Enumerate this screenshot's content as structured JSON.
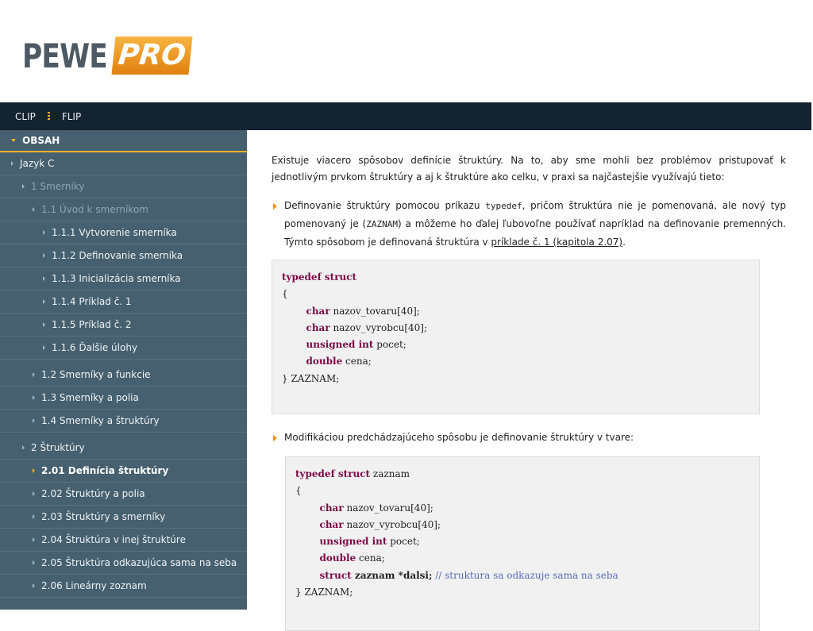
{
  "brand": {
    "part1": "PEWE",
    "part2": "PRO"
  },
  "topbar": {
    "clip": "CLIP",
    "flip": "FLIP"
  },
  "sidebar": {
    "heading": "OBSAH",
    "items": [
      {
        "label": "Jazyk C"
      },
      {
        "label": "1 Smerníky"
      },
      {
        "label": "1.1 Úvod k smerníkom"
      },
      {
        "label": "1.1.1 Vytvorenie smerníka"
      },
      {
        "label": "1.1.2 Definovanie smerníka"
      },
      {
        "label": "1.1.3 Inicializácia smerníka"
      },
      {
        "label": "1.1.4 Príklad č. 1"
      },
      {
        "label": "1.1.5 Príklad č. 2"
      },
      {
        "label": "1.1.6 Ďalšie úlohy"
      },
      {
        "label": "1.2 Smerníky a funkcie"
      },
      {
        "label": "1.3 Smerníky a polia"
      },
      {
        "label": "1.4 Smerníky a štruktúry"
      },
      {
        "label": "2 Štruktúry"
      },
      {
        "label": "2.01 Definícia štruktúry"
      },
      {
        "label": "2.02 Štruktúry a polia"
      },
      {
        "label": "2.03 Štruktúry a smerníky"
      },
      {
        "label": "2.04 Štruktúra v inej štruktúre"
      },
      {
        "label": "2.05 Štruktúra odkazujúca sama na seba"
      },
      {
        "label": "2.06 Lineárny zoznam"
      }
    ]
  },
  "content": {
    "intro": "Existuje viacero spôsobov definície štruktúry. Na to, aby sme mohli bez problémov pristupovať k jednotlivým prvkom štruktúry a aj k štruktúre ako celku, v praxi sa najčastejšie využívajú tieto:",
    "bullet1": {
      "t1": "Definovanie štruktúry pomocou príkazu ",
      "code1": "typedef",
      "t2": ", pričom štruktúra nie je pomenovaná, ale nový typ pomenovaný je (",
      "code2": "ZAZNAM",
      "t3": ") a môžeme ho ďalej ľubovoľne používať napríklad na definovanie premenných. Týmto spôsobom je definovaná štruktúra v ",
      "link": "príklade č. 1 (kapitola 2.07)",
      "t4": "."
    },
    "code1": {
      "l1_kw": "typedef struct",
      "l2": "{",
      "l3_kw": "char",
      "l3": " nazov_tovaru[40];",
      "l4_kw": "char",
      "l4": " nazov_vyrobcu[40];",
      "l5_kw": "unsigned int",
      "l5": " pocet;",
      "l6_kw": "double",
      "l6": " cena;",
      "l7": "} ZAZNAM;"
    },
    "bullet2": "Modifikáciou predchádzajúceho spôsobu je definovanie štruktúry v tvare:",
    "code2": {
      "l1_kw": "typedef struct",
      "l1": " zaznam",
      "l2": "{",
      "l3_kw": "char",
      "l3": " nazov_tovaru[40];",
      "l4_kw": "char",
      "l4": " nazov_vyrobcu[40];",
      "l5_kw": "unsigned int",
      "l5": " pocet;",
      "l6_kw": "double",
      "l6": " cena;",
      "l7_kw": "struct",
      "l7_b": " zaznam *dalsi;",
      "l7_c": " // struktura sa odkazuje sama na seba",
      "l8": "} ZAZNAM;"
    }
  }
}
